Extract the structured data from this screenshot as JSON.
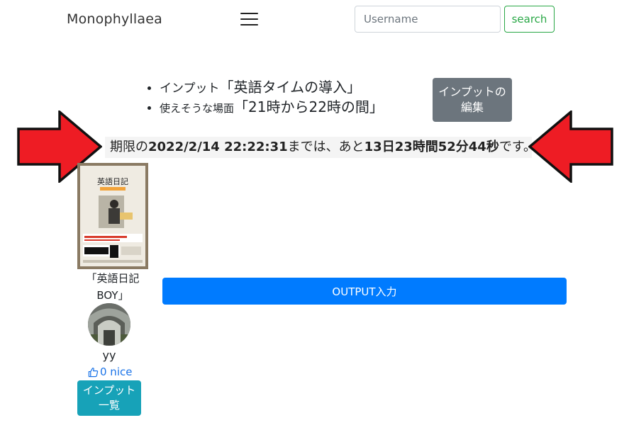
{
  "navbar": {
    "brand": "Monophyllaea",
    "search_placeholder": "Username",
    "search_label": "search"
  },
  "info": {
    "input_prefix": "インプット",
    "input_value": "「英語タイムの導入」",
    "scene_prefix": "使えそうな場面",
    "scene_value": "「21時から22時の間」",
    "edit_label": "インプットの編集"
  },
  "deadline": {
    "prefix": "期限の",
    "datetime": "2022/2/14 22:22:31",
    "middle": "までは、あと",
    "remaining": "13日23時間52分44秒",
    "suffix": "です。"
  },
  "book": {
    "title": "「英語日記BOY」",
    "cover_text": "英語日記"
  },
  "user": {
    "name": "yy",
    "nice_label": "0 nice"
  },
  "buttons": {
    "input_list": "インプット一覧",
    "output": "OUTPUT入力"
  },
  "colors": {
    "arrow": "#ee1c24",
    "output_button": "#007bff",
    "list_button": "#17a2b8",
    "edit_button": "#6c757d",
    "search_button": "#28a745"
  },
  "icons": {
    "menu": "hamburger-icon",
    "nice": "thumbs-up-icon",
    "annotation": "red-arrow"
  }
}
